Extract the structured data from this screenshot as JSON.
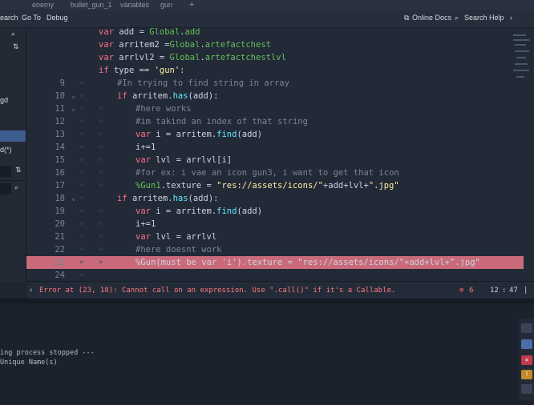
{
  "top_tabs": [
    "enemy",
    "bullet_gun_1",
    "variables",
    "gun"
  ],
  "menu": {
    "search": "Search",
    "goto": "Go To",
    "debug": "Debug",
    "online_docs": "Online Docs",
    "search_help": "Search Help"
  },
  "left_panel": {
    "text_gd": "gd",
    "text_d": "d(*)"
  },
  "colors": {
    "keyword": "#ff7085",
    "function": "#66e6ff",
    "comment": "#7c8594",
    "string": "#ffeda1",
    "node_path": "#63c259",
    "error": "#ff7880",
    "error_line": "#c96a7b"
  },
  "code": {
    "lines": [
      {
        "num": "",
        "ind": 0,
        "parts": [
          [
            "kw",
            "var"
          ],
          [
            "id",
            " add = "
          ],
          [
            "nd",
            "Global"
          ],
          [
            "id",
            "."
          ],
          [
            "nd",
            "add"
          ]
        ]
      },
      {
        "num": "",
        "ind": 0,
        "parts": [
          [
            "kw",
            "var"
          ],
          [
            "id",
            " arritem2 ="
          ],
          [
            "nd",
            "Global"
          ],
          [
            "id",
            "."
          ],
          [
            "nd",
            "artefactchest"
          ]
        ]
      },
      {
        "num": "",
        "ind": 0,
        "parts": [
          [
            "kw",
            "var"
          ],
          [
            "id",
            " arrlvl2 = "
          ],
          [
            "nd",
            "Global"
          ],
          [
            "id",
            "."
          ],
          [
            "nd",
            "artefactchestlvl"
          ]
        ]
      },
      {
        "num": "",
        "ind": 0,
        "parts": [
          [
            "kw",
            "if"
          ],
          [
            "id",
            " type == "
          ],
          [
            "str",
            "'gun'"
          ],
          [
            "id",
            ":"
          ]
        ]
      },
      {
        "num": "9",
        "ind": 1,
        "parts": [
          [
            "cm",
            "#In trying to find string in array"
          ]
        ]
      },
      {
        "num": "10",
        "ind": 1,
        "parts": [
          [
            "kw",
            "if"
          ],
          [
            "id",
            " arritem."
          ],
          [
            "fn",
            "has"
          ],
          [
            "id",
            "(add):"
          ]
        ]
      },
      {
        "num": "11",
        "ind": 2,
        "parts": [
          [
            "cm",
            "#here works"
          ]
        ]
      },
      {
        "num": "12",
        "ind": 2,
        "parts": [
          [
            "cm",
            "#im takind an index of that string"
          ]
        ]
      },
      {
        "num": "13",
        "ind": 2,
        "parts": [
          [
            "kw",
            "var"
          ],
          [
            "id",
            " i = arritem."
          ],
          [
            "fn",
            "find"
          ],
          [
            "id",
            "(add)"
          ]
        ]
      },
      {
        "num": "14",
        "ind": 2,
        "parts": [
          [
            "id",
            "i+=1"
          ]
        ]
      },
      {
        "num": "15",
        "ind": 2,
        "parts": [
          [
            "kw",
            "var"
          ],
          [
            "id",
            " lvl = arrlvl[i]"
          ]
        ]
      },
      {
        "num": "16",
        "ind": 2,
        "parts": [
          [
            "cm",
            "#for ex: i vae an icon gun3, i want to get that icon"
          ]
        ]
      },
      {
        "num": "17",
        "ind": 2,
        "parts": [
          [
            "nd",
            "%Gun1"
          ],
          [
            "id",
            ".texture = "
          ],
          [
            "str",
            "\"res://assets/icons/\""
          ],
          [
            "id",
            "+add+lvl+"
          ],
          [
            "str",
            "\".jpg\""
          ]
        ]
      },
      {
        "num": "18",
        "ind": 1,
        "parts": [
          [
            "kw",
            "if"
          ],
          [
            "id",
            " arritem."
          ],
          [
            "fn",
            "has"
          ],
          [
            "id",
            "(add):"
          ]
        ]
      },
      {
        "num": "19",
        "ind": 2,
        "parts": [
          [
            "kw",
            "var"
          ],
          [
            "id",
            " i = arritem."
          ],
          [
            "fn",
            "find"
          ],
          [
            "id",
            "(add)"
          ]
        ]
      },
      {
        "num": "20",
        "ind": 2,
        "parts": [
          [
            "id",
            "i+=1"
          ]
        ]
      },
      {
        "num": "21",
        "ind": 2,
        "parts": [
          [
            "kw",
            "var"
          ],
          [
            "id",
            " lvl = arrlvl"
          ]
        ]
      },
      {
        "num": "22",
        "ind": 2,
        "parts": [
          [
            "cm",
            "#here doesnt work"
          ]
        ]
      },
      {
        "num": "23",
        "ind": 2,
        "parts": [
          [
            "id",
            "%Gun(must be var 'i').texture = \"res://assets/icons/\"+add+lvl+\".jpg\""
          ]
        ]
      },
      {
        "num": "24",
        "ind": 1,
        "parts": []
      }
    ]
  },
  "status": {
    "error": "Error at (23, 18): Cannot call on an expression. Use \".call()\" if it's a Callable.",
    "error_count": "6",
    "line": "12",
    "col": "47"
  },
  "output": {
    "line1": "ing process stopped ---",
    "line2": "Unique Name(s)"
  }
}
